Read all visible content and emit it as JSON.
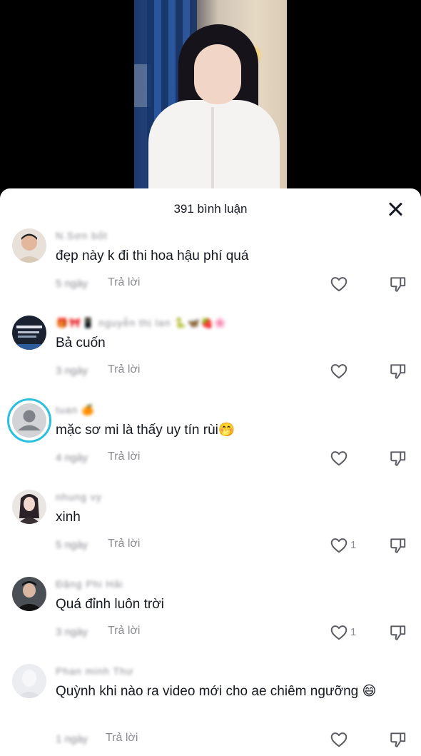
{
  "sheet": {
    "title": "391 bình luận"
  },
  "comments": [
    {
      "username": "N.Sơn bốt",
      "text": "đẹp này k đi thi hoa hậu phí quá",
      "time": "5 ngày",
      "reply_label": "Trả lời",
      "likes": ""
    },
    {
      "username": "🎁🎀📱 nguyễn thị lan 🐍🦋🍓🌸",
      "text": "Bả cuốn",
      "time": "3 ngày",
      "reply_label": "Trả lời",
      "likes": ""
    },
    {
      "username": "tuan 🍊",
      "text": "mặc sơ mi là thấy uy tín rùi🤭",
      "time": "4 ngày",
      "reply_label": "Trả lời",
      "likes": ""
    },
    {
      "username": "nhung vy",
      "text": "xinh",
      "time": "5 ngày",
      "reply_label": "Trả lời",
      "likes": "1"
    },
    {
      "username": "Đặng Phi Hải",
      "text": "Quá đỉnh luôn trời",
      "time": "3 ngày",
      "reply_label": "Trả lời",
      "likes": "1"
    },
    {
      "username": "Phan minh Thư",
      "text": "Quỳnh khi nào ra video mới cho ae chiêm ngưỡng 😄",
      "time": "1 ngày",
      "reply_label": "Trả lời",
      "likes": ""
    }
  ]
}
